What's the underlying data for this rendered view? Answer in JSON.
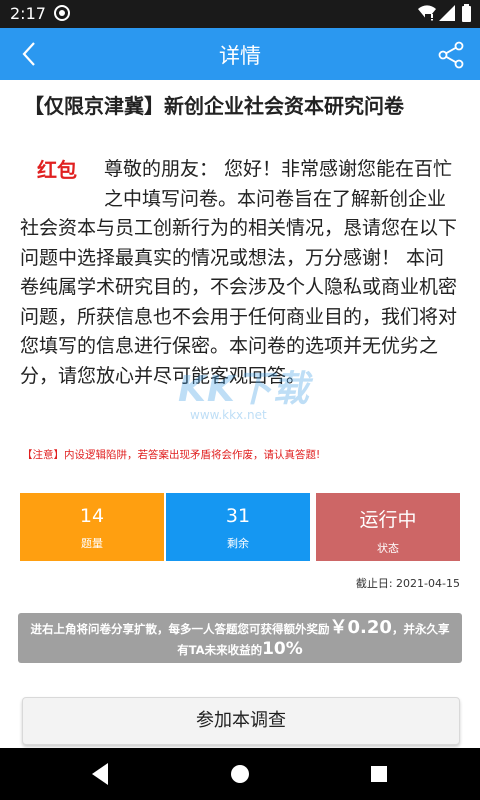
{
  "status_bar": {
    "time": "2:17"
  },
  "app_bar": {
    "title": "详情"
  },
  "survey": {
    "title": "【仅限京津冀】新创企业社会资本研究问卷",
    "red_label": "红包",
    "intro": "尊敬的朋友： 您好！非常感谢您能在百忙之中填写问卷。本问卷旨在了解新创企业社会资本与员工创新行为的相关情况，恳请您在以下问题中选择最真实的情况或想法，万分感谢！ 本问卷纯属学术研究目的，不会涉及个人隐私或商业机密问题，所获信息也不会用于任何商业目的，我们将对您填写的信息进行保密。本问卷的选项并无优劣之分，请您放心并尽可能客观回答。",
    "notice": "【注意】内设逻辑陷阱，若答案出现矛盾将会作废，请认真答题!"
  },
  "watermark": {
    "big": "KK下载",
    "small": "www.kkx.net"
  },
  "stats": [
    {
      "value": "14",
      "label": "题量",
      "color": "#ff9f10"
    },
    {
      "value": "31",
      "label": "剩余",
      "color": "#1597f2"
    },
    {
      "value": "运行中",
      "label": "状态",
      "color": "#cd6666"
    }
  ],
  "deadline": "截止日: 2021-04-15",
  "bonus": {
    "line1_prefix": "进右上角将问卷分享扩散，每多一人答题您可获得额外奖励",
    "amount": "￥0.20",
    "line1_suffix": "，并永久享",
    "line2_prefix": "有TA未来收益的",
    "percent": "10%"
  },
  "join_button": "参加本调查",
  "colors": {
    "status_bar": "#1a1a1a",
    "app_bar": "#2b98f0",
    "accent_red": "#e02020",
    "bonus_bg": "#a0a0a0"
  }
}
